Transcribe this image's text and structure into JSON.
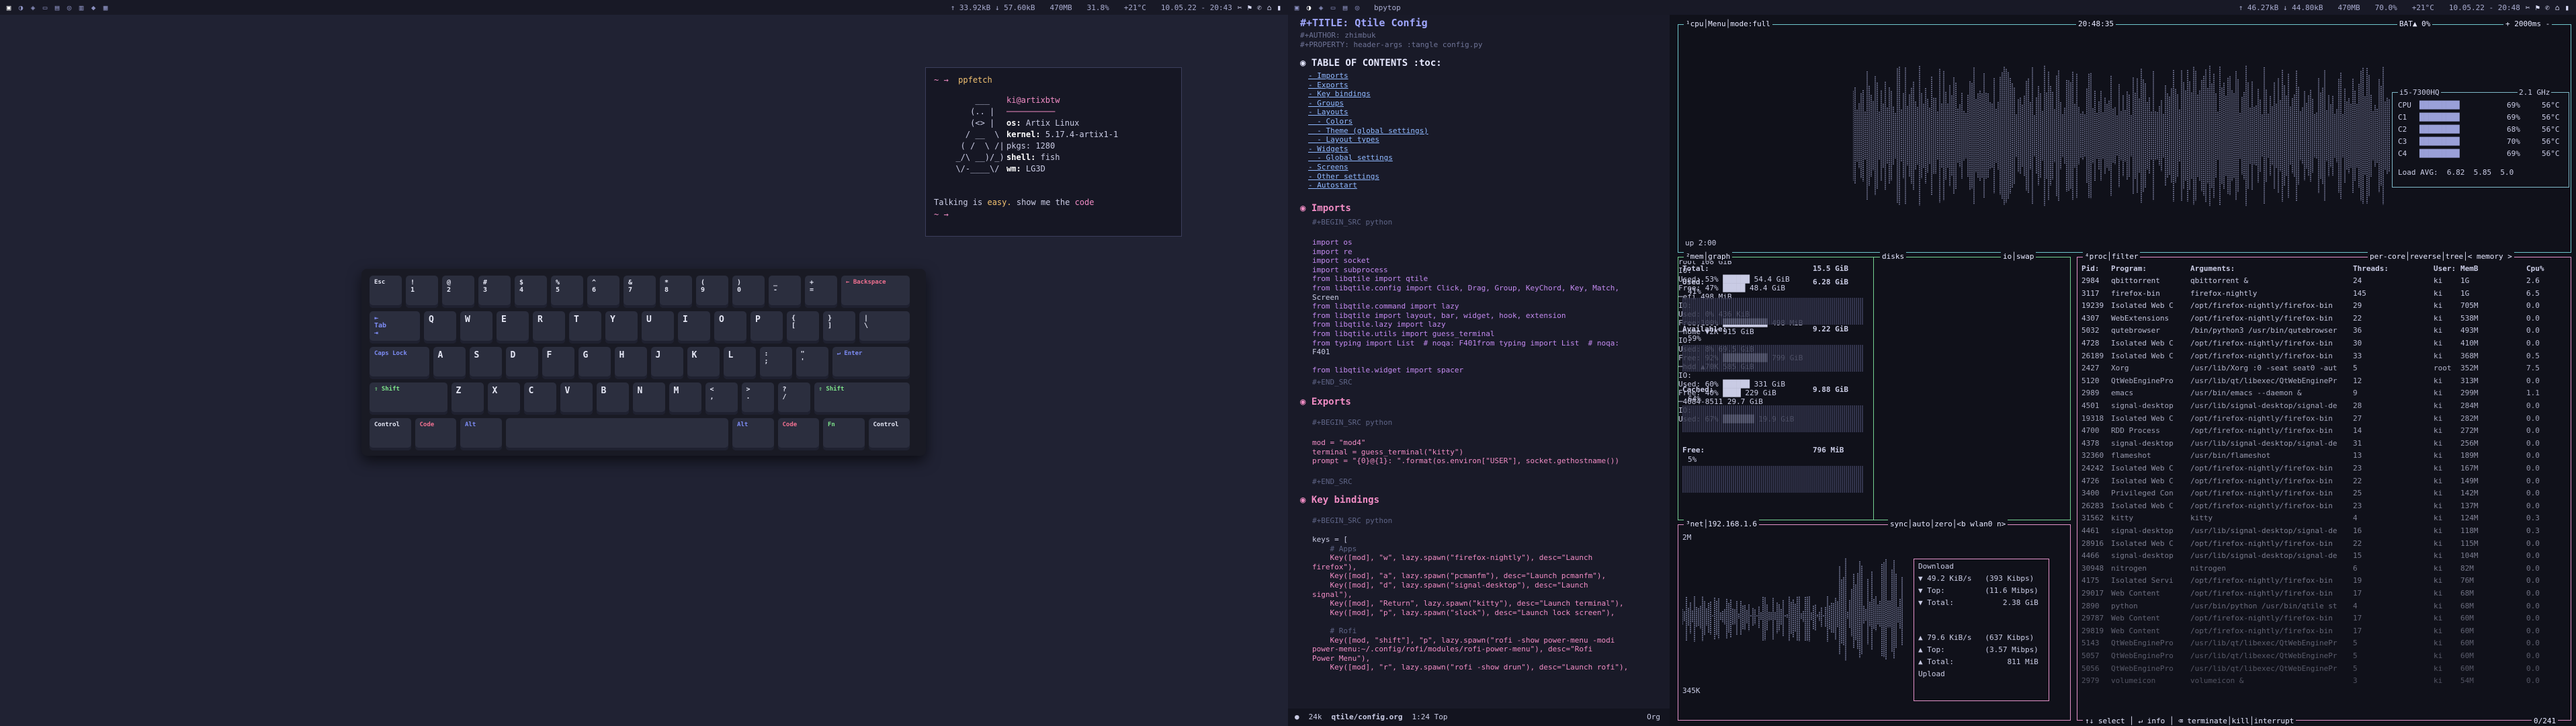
{
  "left_bar": {
    "stats": [
      "↑ 33.92kB ↓ 57.60kB",
      "470MB",
      "31.8%",
      "+21°C",
      "10.05.22 - 20:43"
    ],
    "tray": [
      "✂",
      "⚑",
      "✆",
      "⌂",
      "▮"
    ]
  },
  "right_bar": {
    "window_title": "bpytop",
    "stats": [
      "↑ 46.27kB ↓ 44.80kB",
      "470MB",
      "70.0%",
      "+21°C",
      "10.05.22 - 20:48"
    ],
    "tray": [
      "✂",
      "⚑",
      "✆",
      "⌂",
      "▮"
    ]
  },
  "term": {
    "prompt": "~ →",
    "command": "ppfetch",
    "user": "ki@artixbtw",
    "os_label": "os:",
    "os": "Artix Linux",
    "kernel_label": "kernel:",
    "kernel": "5.17.4-artix1-1",
    "pkgs_label": "pkgs:",
    "pkgs": "1280",
    "shell_label": "shell:",
    "shell": "fish",
    "wm_label": "wm:",
    "wm": "LG3D",
    "talking_pre": "Talking is",
    "talking_easy": "easy.",
    "talking_mid": "show me the",
    "talking_code": "code",
    "prompt2": "~ →"
  },
  "keyboard": {
    "row1": [
      {
        "t": "Esc",
        "c": "mod"
      },
      {
        "t": "!\n1"
      },
      {
        "t": "@\n2"
      },
      {
        "t": "#\n3"
      },
      {
        "t": "$\n4"
      },
      {
        "t": "%\n5"
      },
      {
        "t": "^\n6"
      },
      {
        "t": "&\n7"
      },
      {
        "t": "*\n8"
      },
      {
        "t": "(\n9"
      },
      {
        "t": ")\n0"
      },
      {
        "t": "_\n-"
      },
      {
        "t": "+\n="
      },
      {
        "t": "← Backspace",
        "c": "mod red",
        "w": 2
      }
    ],
    "row2": [
      {
        "t": "⇤\nTab\n⇥",
        "c": "mod blue",
        "w": 1.5
      },
      {
        "t": "Q"
      },
      {
        "t": "W"
      },
      {
        "t": "E"
      },
      {
        "t": "R"
      },
      {
        "t": "T"
      },
      {
        "t": "Y"
      },
      {
        "t": "U"
      },
      {
        "t": "I"
      },
      {
        "t": "O"
      },
      {
        "t": "P"
      },
      {
        "t": "{\n["
      },
      {
        "t": "}\n]"
      },
      {
        "t": "|\n\\",
        "w": 1.5
      }
    ],
    "row3": [
      {
        "t": "Caps Lock",
        "c": "mod blue",
        "w": 1.75
      },
      {
        "t": "A"
      },
      {
        "t": "S"
      },
      {
        "t": "D"
      },
      {
        "t": "F"
      },
      {
        "t": "G"
      },
      {
        "t": "H"
      },
      {
        "t": "J"
      },
      {
        "t": "K"
      },
      {
        "t": "L"
      },
      {
        "t": ":\n;"
      },
      {
        "t": "\"\n'"
      },
      {
        "t": "↵ Enter",
        "c": "mod blue",
        "w": 2.25
      }
    ],
    "row4": [
      {
        "t": "⇧ Shift",
        "c": "mod grn",
        "w": 2.25
      },
      {
        "t": "Z"
      },
      {
        "t": "X"
      },
      {
        "t": "C"
      },
      {
        "t": "V"
      },
      {
        "t": "B"
      },
      {
        "t": "N"
      },
      {
        "t": "M"
      },
      {
        "t": "<\n,"
      },
      {
        "t": ">\n."
      },
      {
        "t": "?\n/"
      },
      {
        "t": "⇧ Shift",
        "c": "mod grn",
        "w": 2.75
      }
    ],
    "row5": [
      {
        "t": "Control",
        "c": "mod yel",
        "w": 1.25
      },
      {
        "t": "Code",
        "c": "mod red",
        "w": 1.25
      },
      {
        "t": "Alt",
        "c": "mod blue",
        "w": 1.25
      },
      {
        "t": "",
        "w": 6.25
      },
      {
        "t": "Alt",
        "c": "mod blue",
        "w": 1.25
      },
      {
        "t": "Code",
        "c": "mod red",
        "w": 1.25
      },
      {
        "t": "Fn",
        "c": "mod grn",
        "w": 1.25
      },
      {
        "t": "Control",
        "c": "mod yel",
        "w": 1.25
      }
    ]
  },
  "editor": {
    "title": "#+TITLE: Qtile Config",
    "author": "#+AUTHOR: zhimbuk",
    "property": "#+PROPERTY: header-args :tangle config.py",
    "toc_heading": "◉ TABLE OF CONTENTS :toc:",
    "toc": [
      "- Imports",
      "- Exports",
      "- Key bindings",
      "- Groups",
      "- Layouts",
      "  - Colors",
      "  - Theme (global settings)",
      "  - Layout types",
      "- Widgets",
      "  - Global settings",
      "- Screens",
      "- Other settings",
      "- Autostart"
    ],
    "imports_heading": "◉ Imports",
    "begin_src": "#+BEGIN_SRC python",
    "imports": [
      "import os",
      "import re",
      "import socket",
      "import subprocess",
      "from libqtile import qtile",
      "from libqtile.config import Click, Drag, Group, KeyChord, Key, Match,",
      "Screen",
      "from libqtile.command import lazy",
      "from libqtile import layout, bar, widget, hook, extension",
      "from libqtile.lazy import lazy",
      "from libqtile.utils import guess_terminal",
      "from typing import List  # noqa: F401from typing import List  # noqa:",
      "F401",
      "",
      "from libqtile.widget import spacer"
    ],
    "end_src": "#+END_SRC",
    "exports_heading": "◉ Exports",
    "exports": [
      "mod = \"mod4\"",
      "terminal = guess_terminal(\"kitty\")",
      "prompt = \"{0}@{1}: \".format(os.environ[\"USER\"], socket.gethostname())"
    ],
    "keyb_heading": "◉ Key bindings",
    "keys": [
      "keys = [",
      "    # Apps",
      "    Key([mod], \"w\", lazy.spawn(\"firefox-nightly\"), desc=\"Launch",
      "firefox\"),",
      "    Key([mod], \"a\", lazy.spawn(\"pcmanfm\"), desc=\"Launch pcmanfm\"),",
      "    Key([mod], \"d\", lazy.spawn(\"signal-desktop\"), desc=\"Launch",
      "signal\"),",
      "    Key([mod], \"Return\", lazy.spawn(\"kitty\"), desc=\"Launch terminal\"),",
      "    Key([mod], \"p\", lazy.spawn(\"slock\"), desc=\"Launch lock screen\"),",
      "",
      "    # Rofi",
      "    Key([mod, \"shift\"], \"p\", lazy.spawn(\"rofi -show power-menu -modi",
      "power-menu:~/.config/rofi/modules/rofi-power-menu\"), desc=\"Rofi",
      "Power Menu\"),",
      "    Key([mod], \"r\", lazy.spawn(\"rofi -show drun\"), desc=\"Launch rofi\"),"
    ],
    "modeline": [
      "●",
      "24k",
      "qtile/config.org",
      "1:24 Top",
      "Org"
    ]
  },
  "bpytop": {
    "cpu_title": "¹cpu│Menu│mode:full",
    "clock": "20:48:35",
    "bat": "BAT▲ 0%",
    "interval": "+ 2000ms -",
    "cpu_model": "i5-7300HQ",
    "freq": "2.1 GHz",
    "cores": [
      {
        "n": "CPU",
        "p": "69%",
        "t": "56°C"
      },
      {
        "n": "C1",
        "p": "69%",
        "t": "56°C"
      },
      {
        "n": "C2",
        "p": "68%",
        "t": "56°C"
      },
      {
        "n": "C3",
        "p": "70%",
        "t": "56°C"
      },
      {
        "n": "C4",
        "p": "69%",
        "t": "56°C"
      }
    ],
    "loadavg": "Load AVG:  6.82  5.85  5.0",
    "uptime": "up 2:00",
    "mem_title": "²mem│graph",
    "mem": [
      {
        "l": "Total:",
        "v": "15.5 GiB"
      },
      {
        "l": "Used:",
        "v": "6.28 GiB",
        "p": "41%"
      },
      {
        "l": "Available:",
        "v": "9.22 GiB",
        "p": "59%"
      },
      {
        "l": "Cached:",
        "v": "9.88 GiB",
        "p": "64%"
      },
      {
        "l": "Free:",
        "v": "796 MiB",
        "p": "5%"
      }
    ],
    "disks_title": "disks",
    "disks": [
      "root                    108 GiB",
      "IO:",
      "Used: 53% ██████     54.4 GiB",
      "Free: 47% █████      48.4 GiB",
      "─efi                    498 MiB",
      "IO:",
      "Used:  0%             436 KiB",
      "Free:100% ██████████ 498 MiB",
      "─home     ▼2K          915 GiB",
      "IO:",
      "Used:  8%               69.5 GiB",
      "Free: 92% ██████████  799 GiB",
      "─hdd      ▲70K         585 GiB",
      "IO:",
      "Used: 60% ██████       331 GiB",
      "Free: 40% ████         229 GiB",
      "─4084-8511             29.7 GiB",
      "IO:",
      "Used: 67% ███████     19.9 GiB"
    ],
    "net_title": "³net│192.168.1.6",
    "net_opts": "sync│auto│zero│<b wlan0 n>",
    "net_top": "2M",
    "net_bottom": "345K",
    "download": [
      "Download",
      "▼ 49.2 KiB/s   (393 Kibps)",
      "▼ Top:         (11.6 Mibps)",
      "▼ Total:           2.38 GiB"
    ],
    "upload": [
      "▲ 79.6 KiB/s   (637 Kibps)",
      "▲ Top:         (3.57 Mibps)",
      "▲ Total:            811 MiB",
      "Upload"
    ],
    "proc_title": "⁴proc│filter",
    "proc_opts": "per-core│reverse│tree│< memory >",
    "proc_header": [
      "Pid:",
      "Program:",
      "Arguments:",
      "Threads:",
      "User:",
      "MemB",
      "Cpu%"
    ],
    "procs": [
      [
        "2984",
        "qbittorrent",
        "qbittorrent &",
        "24",
        "ki",
        "1G",
        "2.6"
      ],
      [
        "3117",
        "firefox-bin",
        "firefox-nightly",
        "145",
        "ki",
        "1G",
        "6.5"
      ],
      [
        "19239",
        "Isolated Web C",
        "/opt/firefox-nightly/firefox-bin",
        "29",
        "ki",
        "705M",
        "0.0"
      ],
      [
        "4307",
        "WebExtensions",
        "/opt/firefox-nightly/firefox-bin",
        "22",
        "ki",
        "538M",
        "0.0"
      ],
      [
        "5032",
        "qutebrowser",
        "/bin/python3 /usr/bin/qutebrowser",
        "36",
        "ki",
        "493M",
        "0.0"
      ],
      [
        "4728",
        "Isolated Web C",
        "/opt/firefox-nightly/firefox-bin",
        "30",
        "ki",
        "410M",
        "0.0"
      ],
      [
        "26189",
        "Isolated Web C",
        "/opt/firefox-nightly/firefox-bin",
        "33",
        "ki",
        "368M",
        "0.5"
      ],
      [
        "2427",
        "Xorg",
        "/usr/lib/Xorg :0 -seat seat0 -aut",
        "5",
        "root",
        "352M",
        "7.5"
      ],
      [
        "5120",
        "QtWebEnginePro",
        "/usr/lib/qt/libexec/QtWebEnginePr",
        "12",
        "ki",
        "313M",
        "0.0"
      ],
      [
        "2989",
        "emacs",
        "/usr/bin/emacs --daemon &",
        "9",
        "ki",
        "299M",
        "1.1"
      ],
      [
        "4501",
        "signal-desktop",
        "/usr/lib/signal-desktop/signal-de",
        "28",
        "ki",
        "284M",
        "0.0"
      ],
      [
        "19318",
        "Isolated Web C",
        "/opt/firefox-nightly/firefox-bin",
        "27",
        "ki",
        "282M",
        "0.0"
      ],
      [
        "4700",
        "RDD Process",
        "/opt/firefox-nightly/firefox-bin",
        "14",
        "ki",
        "272M",
        "0.0"
      ],
      [
        "4378",
        "signal-desktop",
        "/usr/lib/signal-desktop/signal-de",
        "31",
        "ki",
        "256M",
        "0.0"
      ],
      [
        "32360",
        "flameshot",
        "/usr/bin/flameshot",
        "13",
        "ki",
        "189M",
        "0.0"
      ],
      [
        "24242",
        "Isolated Web C",
        "/opt/firefox-nightly/firefox-bin",
        "23",
        "ki",
        "167M",
        "0.0"
      ],
      [
        "4726",
        "Isolated Web C",
        "/opt/firefox-nightly/firefox-bin",
        "22",
        "ki",
        "149M",
        "0.0"
      ],
      [
        "3400",
        "Privileged Con",
        "/opt/firefox-nightly/firefox-bin",
        "25",
        "ki",
        "142M",
        "0.0"
      ],
      [
        "26283",
        "Isolated Web C",
        "/opt/firefox-nightly/firefox-bin",
        "23",
        "ki",
        "137M",
        "0.0"
      ],
      [
        "31562",
        "kitty",
        "kitty",
        "4",
        "ki",
        "124M",
        "0.3"
      ],
      [
        "4461",
        "signal-desktop",
        "/usr/lib/signal-desktop/signal-de",
        "16",
        "ki",
        "118M",
        "0.3"
      ],
      [
        "28916",
        "Isolated Web C",
        "/opt/firefox-nightly/firefox-bin",
        "22",
        "ki",
        "115M",
        "0.0"
      ],
      [
        "4466",
        "signal-desktop",
        "/usr/lib/signal-desktop/signal-de",
        "15",
        "ki",
        "104M",
        "0.0"
      ],
      [
        "30948",
        "nitrogen",
        "nitrogen",
        "6",
        "ki",
        "82M",
        "0.0"
      ],
      [
        "4175",
        "Isolated Servi",
        "/opt/firefox-nightly/firefox-bin",
        "19",
        "ki",
        "76M",
        "0.0"
      ],
      [
        "29017",
        "Web Content",
        "/opt/firefox-nightly/firefox-bin",
        "17",
        "ki",
        "68M",
        "0.0"
      ],
      [
        "2890",
        "python",
        "/usr/bin/python /usr/bin/qtile st",
        "4",
        "ki",
        "68M",
        "0.0"
      ],
      [
        "29787",
        "Web Content",
        "/opt/firefox-nightly/firefox-bin",
        "17",
        "ki",
        "60M",
        "0.0"
      ],
      [
        "29819",
        "Web Content",
        "/opt/firefox-nightly/firefox-bin",
        "17",
        "ki",
        "60M",
        "0.0"
      ],
      [
        "5143",
        "QtWebEnginePro",
        "/usr/lib/qt/libexec/QtWebEnginePr",
        "5",
        "ki",
        "60M",
        "0.0"
      ],
      [
        "5057",
        "QtWebEnginePro",
        "/usr/lib/qt/libexec/QtWebEnginePr",
        "5",
        "ki",
        "60M",
        "0.0"
      ],
      [
        "5056",
        "QtWebEnginePro",
        "/usr/lib/qt/libexec/QtWebEnginePr",
        "5",
        "ki",
        "60M",
        "0.0"
      ],
      [
        "2979",
        "volumeicon",
        "volumeicon &",
        "3",
        "ki",
        "54M",
        "0.0"
      ]
    ],
    "proc_footer": "↑↓ select │ ↵ info │ ⌫ terminate│kill│interrupt",
    "proc_count": "0/241"
  }
}
